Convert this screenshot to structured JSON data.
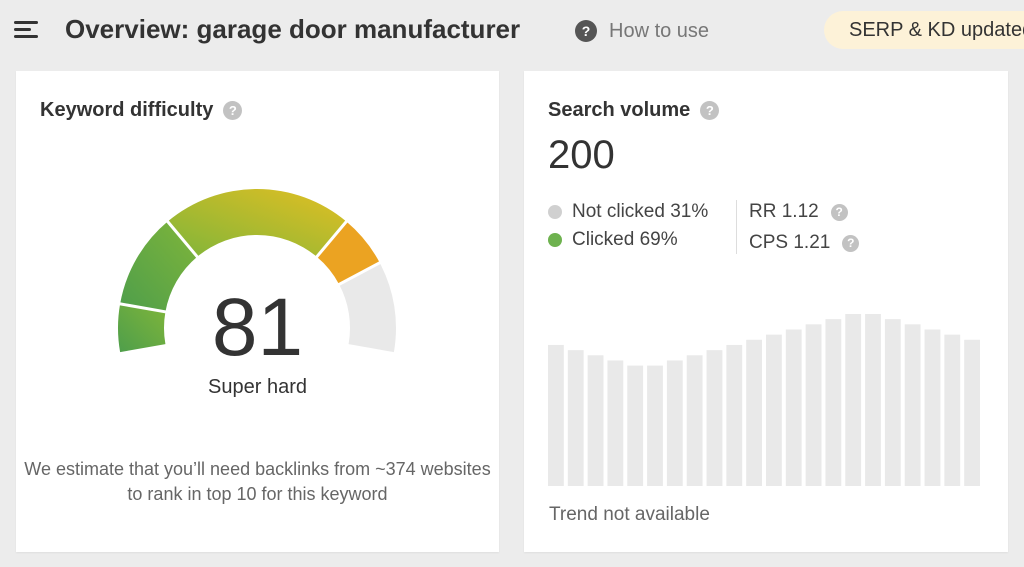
{
  "header": {
    "title": "Overview: garage door manufacturer",
    "how_to_label": "How to use",
    "serp_badge_label": "SERP & KD updated"
  },
  "keyword_difficulty": {
    "title": "Keyword difficulty",
    "value": "81",
    "score": 81,
    "level_label": "Super hard",
    "note": "We estimate that you’ll need backlinks from ~374 websites to rank in top 10 for this keyword",
    "gauge_colors": [
      "#4e9e4b",
      "#7fb53a",
      "#c6c626",
      "#e3bf22",
      "#eba322",
      "#e9e9e9"
    ]
  },
  "search_volume": {
    "title": "Search volume",
    "value": "200",
    "not_clicked_label": "Not clicked 31%",
    "clicked_label": "Clicked 69%",
    "not_clicked_percent": 31,
    "clicked_percent": 69,
    "rr_label": "RR 1.12",
    "cps_label": "CPS 1.21",
    "not_clicked_color": "#d0d0d0",
    "clicked_color": "#6eb24f",
    "trend_note": "Trend not available",
    "trend_values": [
      0.82,
      0.79,
      0.76,
      0.73,
      0.7,
      0.7,
      0.73,
      0.76,
      0.79,
      0.82,
      0.85,
      0.88,
      0.91,
      0.94,
      0.97,
      1.0,
      1.0,
      0.97,
      0.94,
      0.91,
      0.88,
      0.85
    ],
    "trend_bar_color": "#e9e9e9"
  }
}
